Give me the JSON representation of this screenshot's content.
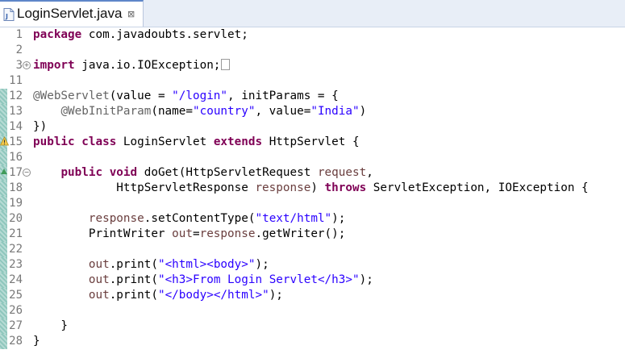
{
  "tab": {
    "title": "LoginServlet.java",
    "close_glyph": "⊠",
    "icon": "java-file-icon"
  },
  "colors": {
    "keyword": "#7f0055",
    "string": "#2a00ff",
    "annotation": "#646464",
    "parameter": "#6a3e3e",
    "gutter_change": "#8fc7bd"
  },
  "lines": [
    {
      "num": "1",
      "code": [
        {
          "t": "package",
          "c": "kw"
        },
        {
          "t": " com.javadoubts.servlet;"
        }
      ]
    },
    {
      "num": "2",
      "code": []
    },
    {
      "num": "3",
      "fold": "+",
      "code": [
        {
          "t": "import",
          "c": "kw"
        },
        {
          "t": " java.io.IOException;"
        },
        {
          "t": "",
          "c": "fold-box"
        }
      ]
    },
    {
      "num": "11",
      "code": []
    },
    {
      "num": "12",
      "changed": true,
      "code": [
        {
          "t": "@WebServlet",
          "c": "ann"
        },
        {
          "t": "(value = "
        },
        {
          "t": "\"/login\"",
          "c": "str"
        },
        {
          "t": ", initParams = {"
        }
      ]
    },
    {
      "num": "13",
      "changed": true,
      "code": [
        {
          "t": "    "
        },
        {
          "t": "@WebInitParam",
          "c": "ann"
        },
        {
          "t": "(name="
        },
        {
          "t": "\"country\"",
          "c": "str"
        },
        {
          "t": ", value="
        },
        {
          "t": "\"India\"",
          "c": "str"
        },
        {
          "t": ")"
        }
      ]
    },
    {
      "num": "14",
      "changed": true,
      "code": [
        {
          "t": "})"
        }
      ]
    },
    {
      "num": "15",
      "changed": true,
      "marker": "warning",
      "code": [
        {
          "t": "public",
          "c": "kw"
        },
        {
          "t": " "
        },
        {
          "t": "class",
          "c": "kw"
        },
        {
          "t": " LoginServlet "
        },
        {
          "t": "extends",
          "c": "kw"
        },
        {
          "t": " HttpServlet {"
        }
      ]
    },
    {
      "num": "16",
      "changed": true,
      "code": []
    },
    {
      "num": "17",
      "changed": true,
      "fold": "−",
      "marker": "override",
      "code": [
        {
          "t": "    "
        },
        {
          "t": "public",
          "c": "kw"
        },
        {
          "t": " "
        },
        {
          "t": "void",
          "c": "kw"
        },
        {
          "t": " doGet(HttpServletRequest "
        },
        {
          "t": "request",
          "c": "param"
        },
        {
          "t": ","
        }
      ]
    },
    {
      "num": "18",
      "changed": true,
      "code": [
        {
          "t": "            HttpServletResponse "
        },
        {
          "t": "response",
          "c": "param"
        },
        {
          "t": ") "
        },
        {
          "t": "throws",
          "c": "kw"
        },
        {
          "t": " ServletException, IOException {"
        }
      ]
    },
    {
      "num": "19",
      "changed": true,
      "code": []
    },
    {
      "num": "20",
      "changed": true,
      "code": [
        {
          "t": "        "
        },
        {
          "t": "response",
          "c": "param"
        },
        {
          "t": ".setContentType("
        },
        {
          "t": "\"text/html\"",
          "c": "str"
        },
        {
          "t": ");"
        }
      ]
    },
    {
      "num": "21",
      "changed": true,
      "code": [
        {
          "t": "        PrintWriter "
        },
        {
          "t": "out",
          "c": "param"
        },
        {
          "t": "="
        },
        {
          "t": "response",
          "c": "param"
        },
        {
          "t": ".getWriter();"
        }
      ]
    },
    {
      "num": "22",
      "changed": true,
      "code": []
    },
    {
      "num": "23",
      "changed": true,
      "code": [
        {
          "t": "        "
        },
        {
          "t": "out",
          "c": "param"
        },
        {
          "t": ".print("
        },
        {
          "t": "\"<html><body>\"",
          "c": "str"
        },
        {
          "t": ");"
        }
      ]
    },
    {
      "num": "24",
      "changed": true,
      "code": [
        {
          "t": "        "
        },
        {
          "t": "out",
          "c": "param"
        },
        {
          "t": ".print("
        },
        {
          "t": "\"<h3>From Login Servlet</h3>\"",
          "c": "str"
        },
        {
          "t": ");"
        }
      ]
    },
    {
      "num": "25",
      "changed": true,
      "code": [
        {
          "t": "        "
        },
        {
          "t": "out",
          "c": "param"
        },
        {
          "t": ".print("
        },
        {
          "t": "\"</body></html>\"",
          "c": "str"
        },
        {
          "t": ");"
        }
      ]
    },
    {
      "num": "26",
      "changed": true,
      "code": []
    },
    {
      "num": "27",
      "changed": true,
      "code": [
        {
          "t": "    }"
        }
      ]
    },
    {
      "num": "28",
      "changed": true,
      "code": [
        {
          "t": "}"
        }
      ]
    }
  ]
}
